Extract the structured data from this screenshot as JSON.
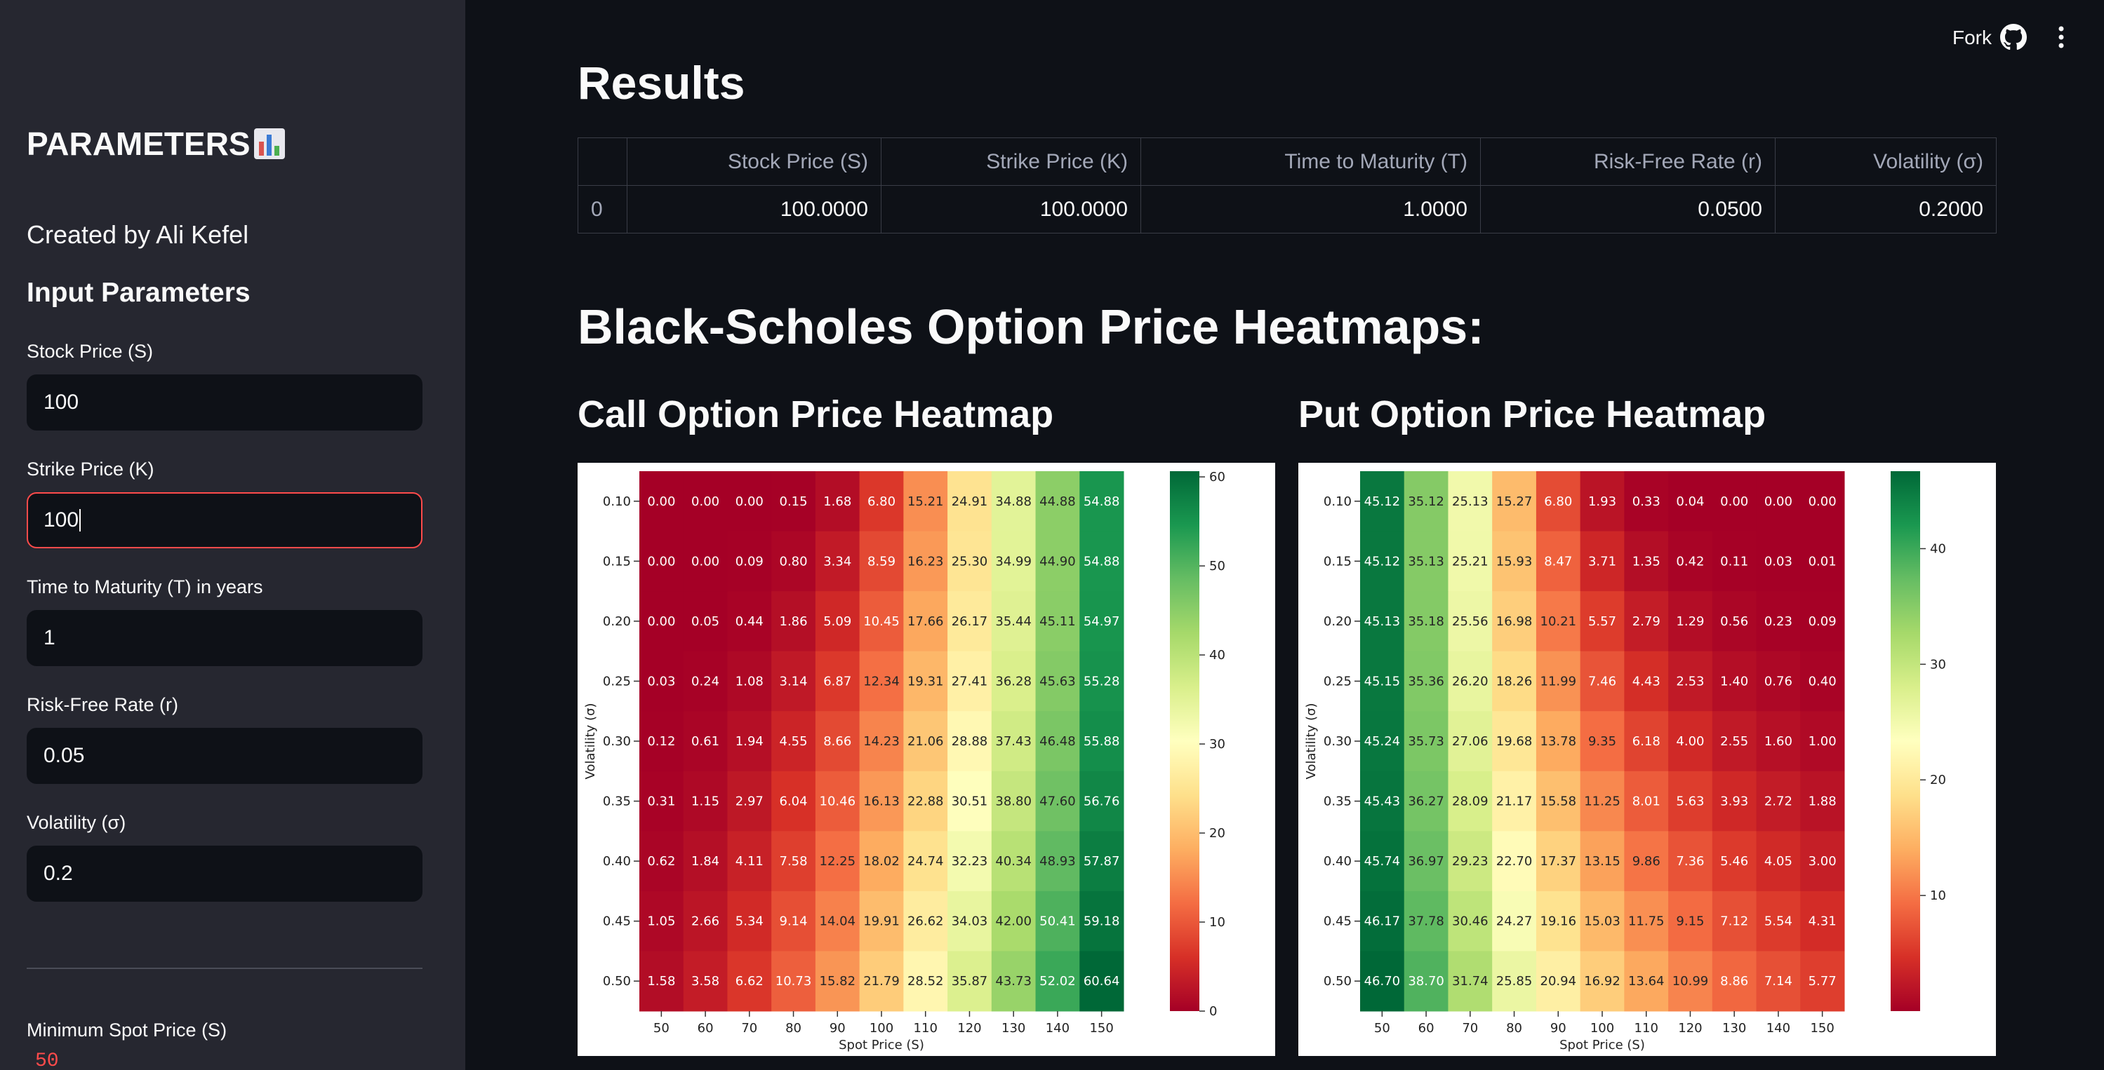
{
  "sidebar": {
    "title": "PARAMETERS",
    "created_by": "Created by Ali Kefel",
    "section_title": "Input Parameters",
    "fields": [
      {
        "label": "Stock Price (S)",
        "value": "100"
      },
      {
        "label": "Strike Price (K)",
        "value": "100"
      },
      {
        "label": "Time to Maturity (T) in years",
        "value": "1"
      },
      {
        "label": "Risk-Free Rate (r)",
        "value": "0.05"
      },
      {
        "label": "Volatility (σ)",
        "value": "0.2"
      }
    ],
    "min_spot_label": "Minimum Spot Price (S)",
    "min_spot_value": "50"
  },
  "topbar": {
    "fork_label": "Fork",
    "icons": [
      "github-icon",
      "more-vertical-icon"
    ]
  },
  "main": {
    "results_title": "Results",
    "table": {
      "headers": [
        "",
        "Stock Price (S)",
        "Strike Price (K)",
        "Time to Maturity (T)",
        "Risk-Free Rate (r)",
        "Volatility (σ)"
      ],
      "rows": [
        [
          "0",
          "100.0000",
          "100.0000",
          "1.0000",
          "0.0500",
          "0.2000"
        ]
      ]
    },
    "heatmaps_title": "Black-Scholes Option Price Heatmaps:",
    "call_title": "Call Option Price Heatmap",
    "put_title": "Put Option Price Heatmap"
  },
  "chart_data": [
    {
      "type": "heatmap",
      "name": "call",
      "xlabel": "Spot Price (S)",
      "ylabel": "Volatility (σ)",
      "x": [
        50,
        60,
        70,
        80,
        90,
        100,
        110,
        120,
        130,
        140,
        150
      ],
      "y": [
        "0.10",
        "0.15",
        "0.20",
        "0.25",
        "0.30",
        "0.35",
        "0.40",
        "0.45",
        "0.50"
      ],
      "values": [
        [
          "0.00",
          "0.00",
          "0.00",
          "0.15",
          "1.68",
          "6.80",
          "15.21",
          "24.91",
          "34.88",
          "44.88",
          "54.88"
        ],
        [
          "0.00",
          "0.00",
          "0.09",
          "0.80",
          "3.34",
          "8.59",
          "16.23",
          "25.30",
          "34.99",
          "44.90",
          "54.88"
        ],
        [
          "0.00",
          "0.05",
          "0.44",
          "1.86",
          "5.09",
          "10.45",
          "17.66",
          "26.17",
          "35.44",
          "45.11",
          "54.97"
        ],
        [
          "0.03",
          "0.24",
          "1.08",
          "3.14",
          "6.87",
          "12.34",
          "19.31",
          "27.41",
          "36.28",
          "45.63",
          "55.28"
        ],
        [
          "0.12",
          "0.61",
          "1.94",
          "4.55",
          "8.66",
          "14.23",
          "21.06",
          "28.88",
          "37.43",
          "46.48",
          "55.88"
        ],
        [
          "0.31",
          "1.15",
          "2.97",
          "6.04",
          "10.46",
          "16.13",
          "22.88",
          "30.51",
          "38.80",
          "47.60",
          "56.76"
        ],
        [
          "0.62",
          "1.84",
          "4.11",
          "7.58",
          "12.25",
          "18.02",
          "24.74",
          "32.23",
          "40.34",
          "48.93",
          "57.87"
        ],
        [
          "1.05",
          "2.66",
          "5.34",
          "9.14",
          "14.04",
          "19.91",
          "26.62",
          "34.03",
          "42.00",
          "50.41",
          "59.18"
        ],
        [
          "1.58",
          "3.58",
          "6.62",
          "10.73",
          "15.82",
          "21.79",
          "28.52",
          "35.87",
          "43.73",
          "52.02",
          "60.64"
        ]
      ],
      "colorbar_ticks": [
        0,
        10,
        20,
        30,
        40,
        50,
        60
      ],
      "vmin": 0,
      "vmax": 60.64,
      "colormap": "RdYlGn"
    },
    {
      "type": "heatmap",
      "name": "put",
      "xlabel": "Spot Price (S)",
      "ylabel": "Volatility (σ)",
      "x": [
        50,
        60,
        70,
        80,
        90,
        100,
        110,
        120,
        130,
        140,
        150
      ],
      "y": [
        "0.10",
        "0.15",
        "0.20",
        "0.25",
        "0.30",
        "0.35",
        "0.40",
        "0.45",
        "0.50"
      ],
      "values": [
        [
          "45.12",
          "35.12",
          "25.13",
          "15.27",
          "6.80",
          "1.93",
          "0.33",
          "0.04",
          "0.00",
          "0.00",
          "0.00"
        ],
        [
          "45.12",
          "35.13",
          "25.21",
          "15.93",
          "8.47",
          "3.71",
          "1.35",
          "0.42",
          "0.11",
          "0.03",
          "0.01"
        ],
        [
          "45.13",
          "35.18",
          "25.56",
          "16.98",
          "10.21",
          "5.57",
          "2.79",
          "1.29",
          "0.56",
          "0.23",
          "0.09"
        ],
        [
          "45.15",
          "35.36",
          "26.20",
          "18.26",
          "11.99",
          "7.46",
          "4.43",
          "2.53",
          "1.40",
          "0.76",
          "0.40"
        ],
        [
          "45.24",
          "35.73",
          "27.06",
          "19.68",
          "13.78",
          "9.35",
          "6.18",
          "4.00",
          "2.55",
          "1.60",
          "1.00"
        ],
        [
          "45.43",
          "36.27",
          "28.09",
          "21.17",
          "15.58",
          "11.25",
          "8.01",
          "5.63",
          "3.93",
          "2.72",
          "1.88"
        ],
        [
          "45.74",
          "36.97",
          "29.23",
          "22.70",
          "17.37",
          "13.15",
          "9.86",
          "7.36",
          "5.46",
          "4.05",
          "3.00"
        ],
        [
          "46.17",
          "37.78",
          "30.46",
          "24.27",
          "19.16",
          "15.03",
          "11.75",
          "9.15",
          "7.12",
          "5.54",
          "4.31"
        ],
        [
          "46.70",
          "38.70",
          "31.74",
          "25.85",
          "20.94",
          "16.92",
          "13.64",
          "10.99",
          "8.86",
          "7.14",
          "5.77"
        ]
      ],
      "colorbar_ticks": [
        10,
        20,
        30,
        40
      ],
      "vmin": 0,
      "vmax": 46.7,
      "colormap": "RdYlGn"
    }
  ]
}
